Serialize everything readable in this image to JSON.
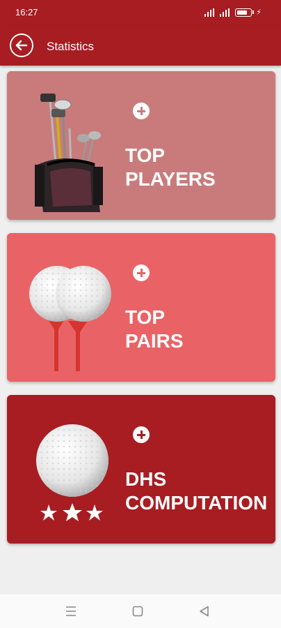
{
  "status_bar": {
    "time": "16:27"
  },
  "app_bar": {
    "title": "Statistics",
    "back_icon": "arrow-left-icon"
  },
  "cards": [
    {
      "line1": "TOP",
      "line2": "PLAYERS",
      "bg_color": "#c97b7c",
      "icon": "golf-bag-icon",
      "plus_icon": "plus-circle-icon"
    },
    {
      "line1": "TOP",
      "line2": "PAIRS",
      "bg_color": "#e96366",
      "icon": "golf-balls-on-tees-icon",
      "plus_icon": "plus-circle-icon"
    },
    {
      "line1": "DHS",
      "line2": "COMPUTATION",
      "bg_color": "#a71d22",
      "icon": "golf-ball-stars-icon",
      "plus_icon": "plus-circle-icon"
    }
  ],
  "nav_bar": {
    "icons": [
      "menu-icon",
      "home-square-icon",
      "back-triangle-icon"
    ]
  },
  "colors": {
    "primary": "#a71d22",
    "background": "#efefef"
  }
}
